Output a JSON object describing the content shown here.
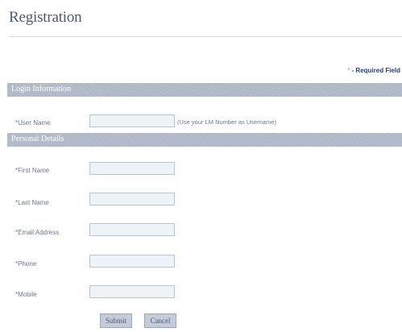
{
  "page": {
    "title": "Registration"
  },
  "required_note": {
    "marker": "*",
    "text": "- Required Field"
  },
  "sections": {
    "login": {
      "title": "Login Information"
    },
    "personal": {
      "title": "Personal Details"
    }
  },
  "fields": {
    "user_name": {
      "label": "*User Name",
      "value": "",
      "hint": "(Use your LM Number as Username)"
    },
    "first_name": {
      "label": "*First Name",
      "value": ""
    },
    "last_name": {
      "label": "*Last Name",
      "value": ""
    },
    "email": {
      "label": "*Email Address",
      "value": ""
    },
    "phone": {
      "label": "*Phone",
      "value": ""
    },
    "mobile": {
      "label": "*Mobile",
      "value": ""
    }
  },
  "buttons": {
    "submit": "Submit",
    "cancel": "Cancel"
  }
}
